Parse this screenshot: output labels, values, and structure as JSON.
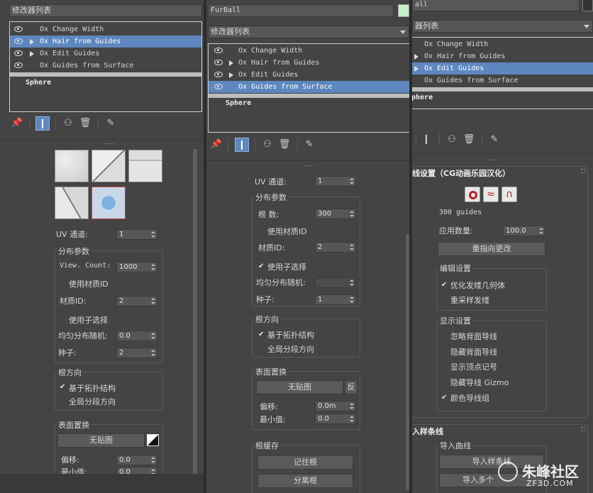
{
  "panel_left": {
    "modifier_list_label": "修改器列表",
    "stack_items": [
      {
        "label": "Ox Change Width",
        "arrow": false,
        "selected": false
      },
      {
        "label": "Ox Hair from Guides",
        "arrow": true,
        "selected": true
      },
      {
        "label": "Ox Edit Guides",
        "arrow": true,
        "selected": false
      },
      {
        "label": "Ox Guides from Surface",
        "arrow": false,
        "selected": false
      }
    ],
    "base_object": "Sphere",
    "uv_channel_label": "UV 通道:",
    "uv_channel_value": "1",
    "distribution_group": "分布参数",
    "view_count_label": "View. Count:",
    "view_count_value": "1000",
    "use_material_id": "使用材质ID",
    "material_id_label": "材质ID:",
    "material_id_value": "2",
    "use_sub_selection": "使用子选择",
    "uniform_random_label": "均匀分布随机:",
    "uniform_random_value": "0.0",
    "seed_label": "种子:",
    "seed_value": "2",
    "root_dir_group": "根方向",
    "topology_based": "基于拓扑结构",
    "global_segment": "全局分段方向",
    "surface_disp_group": "表面置换",
    "no_map_button": "无贴图",
    "offset_label": "偏移:",
    "offset_value": "0.0",
    "min_value_label": "最小值:",
    "min_value_value": "0.0"
  },
  "panel_mid": {
    "object_name": "FurBall",
    "object_color": "#c8f0c8",
    "modifier_list_label": "修改器列表",
    "stack_items": [
      {
        "label": "Ox Change Width",
        "arrow": false,
        "selected": false
      },
      {
        "label": "Ox Hair from Guides",
        "arrow": true,
        "selected": false
      },
      {
        "label": "Ox Edit Guides",
        "arrow": true,
        "selected": false
      },
      {
        "label": "Ox Guides from Surface",
        "arrow": false,
        "selected": true
      }
    ],
    "base_object": "Sphere",
    "uv_channel_label": "UV 通道:",
    "uv_channel_value": "1",
    "distribution_group": "分布参数",
    "root_count_label": "根 数:",
    "root_count_value": "300",
    "use_material_id": "使用材质ID",
    "material_id_label": "材质ID:",
    "material_id_value": "2",
    "use_sub_selection": "使用子选择",
    "uniform_random_label": "均匀分布随机:",
    "uniform_random_value": "",
    "seed_label": "种子:",
    "seed_value": "1",
    "root_dir_group": "根方向",
    "topology_based": "基于拓扑结构",
    "global_segment": "全局分段方向",
    "surface_disp_group": "表面置换",
    "no_map_button": "无贴图",
    "invert_button": "反",
    "offset_label": "偏移:",
    "offset_value": "0.0m",
    "min_value_label": "最小值:",
    "min_value_value": "0.0",
    "root_cache_group": "根缓存",
    "remember_roots_button": "记住根",
    "detach_roots_button": "分离根"
  },
  "panel_right": {
    "object_name": "all",
    "modifier_list_label": "器列表",
    "stack_items": [
      {
        "label": "Ox Change Width",
        "arrow": false,
        "selected": false
      },
      {
        "label": "Ox Hair from Guides",
        "arrow": true,
        "selected": false
      },
      {
        "label": "Ox Edit Guides",
        "arrow": true,
        "selected": true
      },
      {
        "label": "Ox Guides from Surface",
        "arrow": false,
        "selected": false
      }
    ],
    "base_object": "phere",
    "rollout_title": "线设置（CG动画乐园汉化）",
    "guides_count": "300 guides",
    "apply_count_label": "应用数量:",
    "apply_count_value": "100.0",
    "redirect_button": "重指向更改",
    "edit_settings_group": "编辑设置",
    "optimize_geo": "优化发缕几何体",
    "resample": "重采样发缕",
    "display_group": "显示设置",
    "ignore_back": "忽略背面导线",
    "hide_back": "隐藏背面导线",
    "show_vertex": "显示顶点记号",
    "hide_gizmo": "隐藏导线 Gizmo",
    "color_guides": "颜色导线组",
    "import_rollout": "入样条线",
    "import_curve_group": "导入曲线",
    "import_spline_button": "导入样条线",
    "import_multi_button": "导入多个"
  },
  "watermark": {
    "brand": "朱峰社区",
    "url": "ZF3D.COM"
  },
  "colors": {
    "selection": "#5d87be",
    "panel_bg": "#444444"
  }
}
